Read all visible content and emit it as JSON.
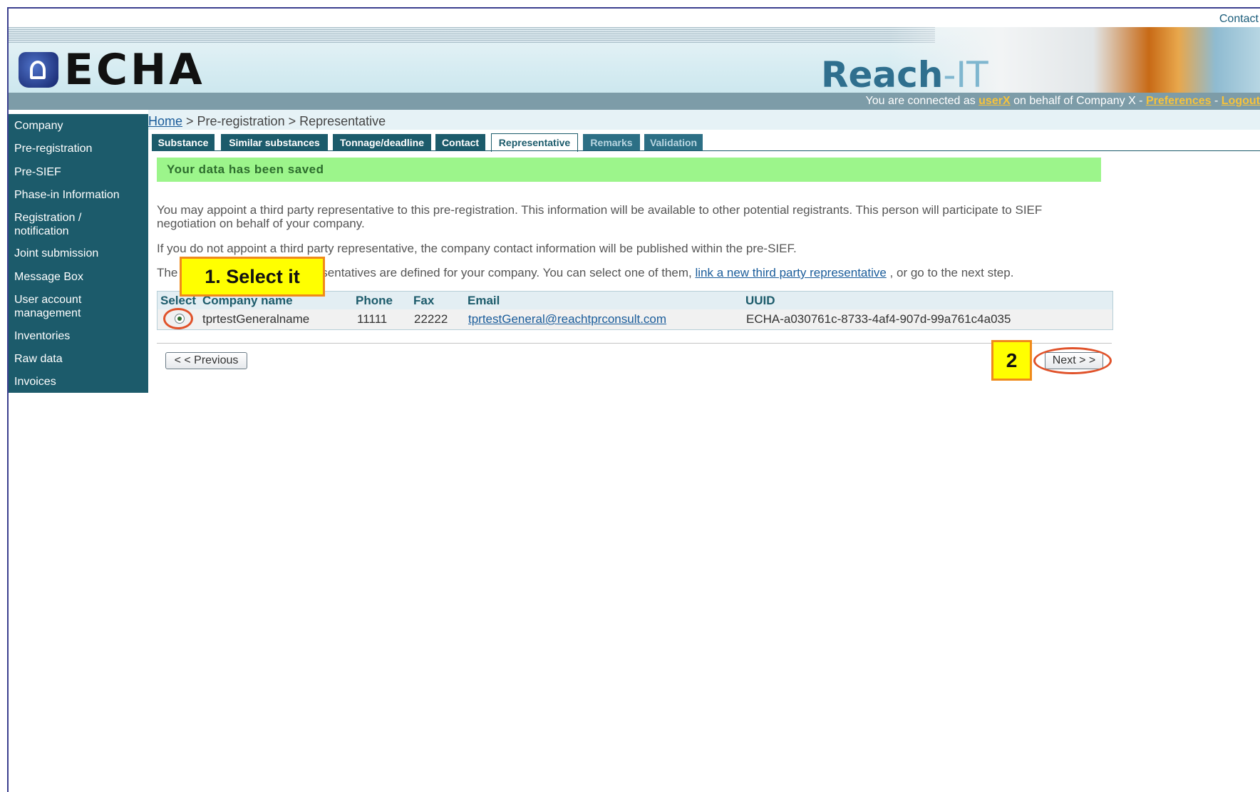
{
  "header": {
    "contact_link": "Contact",
    "logo_text": "ECHA",
    "app_title_main": "Reach",
    "app_title_suffix": "-IT",
    "connected_prefix": "You are connected as ",
    "user": "userX",
    "connected_mid": " on behalf of Company X - ",
    "preferences": "Preferences",
    "separator": " - ",
    "logout": "Logout"
  },
  "sidebar": {
    "items": [
      {
        "label": "Company"
      },
      {
        "label": "Pre-registration"
      },
      {
        "label": "Pre-SIEF"
      },
      {
        "label": "Phase-in Information"
      },
      {
        "label": "Registration /\nnotification"
      },
      {
        "label": "Joint submission"
      },
      {
        "label": "Message Box"
      },
      {
        "label": "User account\nmanagement"
      },
      {
        "label": "Inventories"
      },
      {
        "label": "Raw data"
      },
      {
        "label": "Invoices"
      }
    ]
  },
  "breadcrumb": {
    "home": "Home",
    "rest": " > Pre-registration > Representative"
  },
  "tabs": [
    {
      "label": "Substance"
    },
    {
      "label": "Similar substances"
    },
    {
      "label": "Tonnage/deadline"
    },
    {
      "label": "Contact"
    },
    {
      "label": "Representative"
    },
    {
      "label": "Remarks"
    },
    {
      "label": "Validation"
    }
  ],
  "saved_message": "Your data has been saved",
  "paragraphs": {
    "p1": "You may appoint a third party representative to this pre-registration. This information will be available to other potential registrants. This person will participate to SIEF negotiation on behalf of your company.",
    "p2": "If you do not appoint a third party representative, the company contact information will be published within the pre-SIEF.",
    "p3_start": "The",
    "p3_mid": "sentatives are defined for your company. You can select one of them, ",
    "p3_link": "link a new third party representative",
    "p3_end": " , or go to the next step."
  },
  "table": {
    "headers": {
      "select": "Select",
      "company": "Company name",
      "phone": "Phone",
      "fax": "Fax",
      "email": "Email",
      "uuid": "UUID"
    },
    "rows": [
      {
        "company": "tprtestGeneralname",
        "phone": "11111",
        "fax": "22222",
        "email": "tprtestGeneral@reachtprconsult.com",
        "uuid": "ECHA-a030761c-8733-4af4-907d-99a761c4a035",
        "selected": true
      }
    ]
  },
  "buttons": {
    "previous": "< < Previous",
    "next": "Next > >"
  },
  "callouts": {
    "step1": "1. Select it",
    "step2": "2"
  },
  "colors": {
    "sidebar_bg": "#1c5b6b",
    "saved_bg": "#9cf58b",
    "callout_bg": "#ffff00",
    "callout_border": "#f08a1a",
    "highlight_ring": "#e0522a"
  }
}
